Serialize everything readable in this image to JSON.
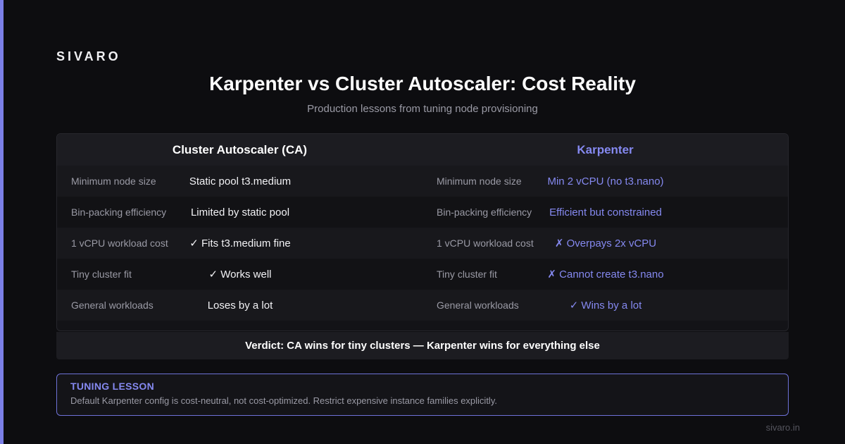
{
  "brand": "SIVARO",
  "title": "Karpenter vs Cluster Autoscaler: Cost Reality",
  "subtitle": "Production lessons from tuning node provisioning",
  "colors": {
    "accent": "#7b7fe6",
    "karpenter_text": "#8589f0",
    "background": "#0d0d10"
  },
  "columns": [
    {
      "heading": "Cluster Autoscaler (CA)",
      "rows": [
        {
          "label": "Minimum node size",
          "value": "Static pool t3.medium"
        },
        {
          "label": "Bin-packing efficiency",
          "value": "Limited by static pool"
        },
        {
          "label": "1 vCPU workload cost",
          "value": "✓ Fits t3.medium fine"
        },
        {
          "label": "Tiny cluster fit",
          "value": "✓ Works well"
        },
        {
          "label": "General workloads",
          "value": "Loses by a lot"
        }
      ]
    },
    {
      "heading": "Karpenter",
      "rows": [
        {
          "label": "Minimum node size",
          "value": "Min 2 vCPU (no t3.nano)"
        },
        {
          "label": "Bin-packing efficiency",
          "value": "Efficient but constrained"
        },
        {
          "label": "1 vCPU workload cost",
          "value": "✗ Overpays 2x vCPU"
        },
        {
          "label": "Tiny cluster fit",
          "value": "✗ Cannot create t3.nano"
        },
        {
          "label": "General workloads",
          "value": "✓ Wins by a lot"
        }
      ]
    }
  ],
  "verdict": "Verdict: CA wins for tiny clusters — Karpenter wins for everything else",
  "lesson": {
    "title": "TUNING LESSON",
    "body": "Default Karpenter config is cost-neutral, not cost-optimized. Restrict expensive instance families explicitly."
  },
  "footer": "sivaro.in"
}
